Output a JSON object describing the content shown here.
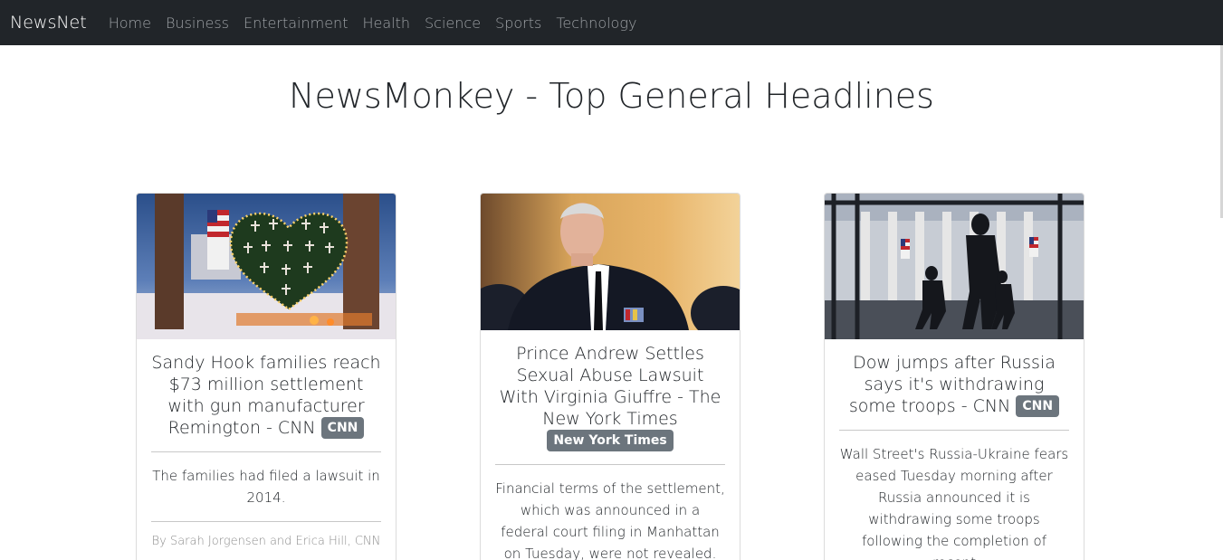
{
  "navbar": {
    "brand": "NewsNet",
    "links": [
      "Home",
      "Business",
      "Entertainment",
      "Health",
      "Science",
      "Sports",
      "Technology"
    ]
  },
  "page": {
    "title": "NewsMonkey - Top General Headlines"
  },
  "articles": [
    {
      "title": "Sandy Hook families reach $73 million settlement with gun manufacturer Remington - CNN",
      "source": "CNN",
      "description": "The families had filed a lawsuit in 2014.",
      "author": "By Sarah Jorgensen and Erica Hill, CNN"
    },
    {
      "title": "Prince Andrew Settles Sexual Abuse Lawsuit With Virginia Giuffre - The New York Times",
      "source": "New York Times",
      "description": "Financial terms of the settlement, which was announced in a federal court filing in Manhattan on Tuesday, were not revealed."
    },
    {
      "title": "Dow jumps after Russia says it's withdrawing some troops - CNN",
      "source": "CNN",
      "description": "Wall Street's Russia-Ukraine fears eased Tuesday morning after Russia announced it is withdrawing some troops following the completion of recent"
    }
  ]
}
